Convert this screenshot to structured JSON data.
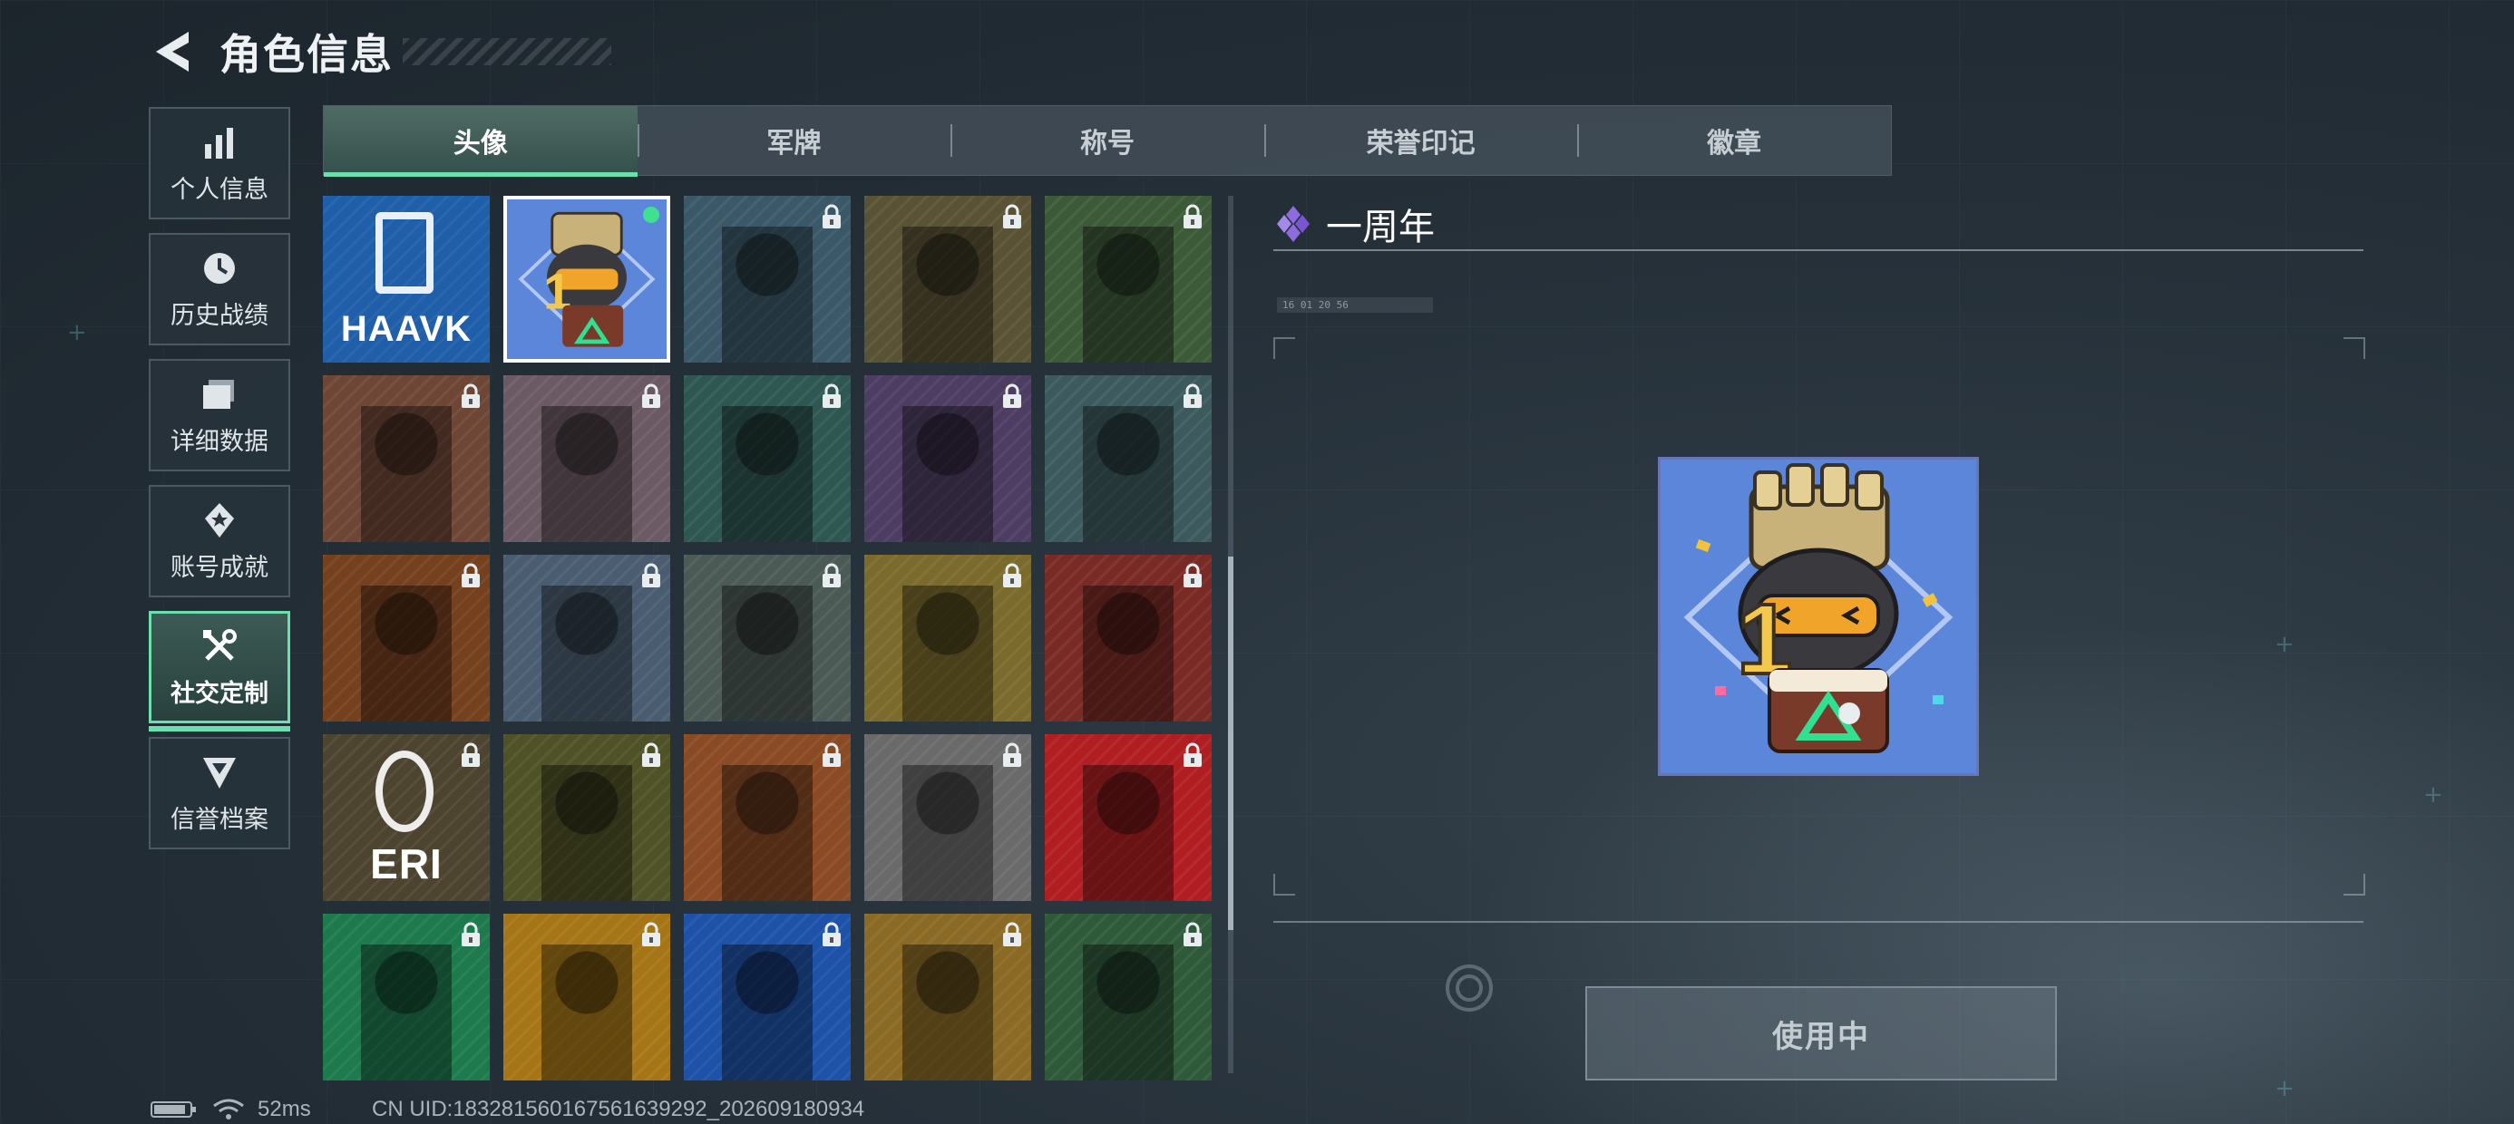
{
  "header": {
    "title": "角色信息"
  },
  "sidebar": {
    "items": [
      {
        "label": "个人信息",
        "icon": "bar-chart-icon"
      },
      {
        "label": "历史战绩",
        "icon": "history-clock-icon"
      },
      {
        "label": "详细数据",
        "icon": "folder-icon"
      },
      {
        "label": "账号成就",
        "icon": "medal-icon"
      },
      {
        "label": "社交定制",
        "icon": "tools-icon",
        "active": true
      },
      {
        "label": "信誉档案",
        "icon": "shield-chevron-icon"
      }
    ]
  },
  "tabs": [
    {
      "label": "头像",
      "active": true
    },
    {
      "label": "军牌"
    },
    {
      "label": "称号"
    },
    {
      "label": "荣誉印记"
    },
    {
      "label": "徽章"
    }
  ],
  "avatar_grid": {
    "columns": 5,
    "items": [
      {
        "name": "haavk-logo",
        "logo_text": "HAAVK",
        "bg": "#1f5ea8",
        "locked": false
      },
      {
        "name": "anniversary-mascot",
        "bg": "#4e7fd6",
        "locked": false,
        "selected": true,
        "equipped": true
      },
      {
        "name": "pilot-woman",
        "bg": "#3a5868",
        "locked": true
      },
      {
        "name": "bald-operator",
        "bg": "#5a5234",
        "locked": true
      },
      {
        "name": "headset-operator",
        "bg": "#3c5a38",
        "locked": true
      },
      {
        "name": "helmet-soldier",
        "bg": "#6e4636",
        "locked": true
      },
      {
        "name": "white-hair-woman",
        "bg": "#6b5a64",
        "locked": true
      },
      {
        "name": "glasses-operator",
        "bg": "#2f5752",
        "locked": true
      },
      {
        "name": "purple-hair-woman",
        "bg": "#4d3d62",
        "locked": true
      },
      {
        "name": "masked-soldier",
        "bg": "#3c5a5e",
        "locked": true
      },
      {
        "name": "scarf-operator",
        "bg": "#74401e",
        "locked": true
      },
      {
        "name": "gear-star-emblem",
        "bg": "#4a5d70",
        "locked": true
      },
      {
        "name": "helicopter-field",
        "bg": "#4c5a56",
        "locked": true
      },
      {
        "name": "mascot-eating",
        "bg": "#7a6a2c",
        "locked": true
      },
      {
        "name": "red-hair-woman",
        "bg": "#7a2a24",
        "locked": true
      },
      {
        "name": "eri-globe-emblem",
        "logo_text": "ERI",
        "bg": "#4d4430",
        "locked": true
      },
      {
        "name": "glasses-man",
        "bg": "#4f5226",
        "locked": true
      },
      {
        "name": "explosion",
        "bg": "#8a4a24",
        "locked": true
      },
      {
        "name": "pistol-soldier",
        "bg": "#6a6a6a",
        "locked": true
      },
      {
        "name": "shield-emblem-red",
        "bg": "#b01e22",
        "locked": true
      },
      {
        "name": "cross-emblem-green",
        "bg": "#1d7a4c",
        "locked": true
      },
      {
        "name": "a-emblem-orange",
        "bg": "#a67616",
        "locked": true
      },
      {
        "name": "hex-emblem-blue",
        "bg": "#1d52a8",
        "locked": true
      },
      {
        "name": "diamond-emblem-gold",
        "bg": "#8a6a24",
        "locked": true
      },
      {
        "name": "cap-woman",
        "bg": "#2f5a3a",
        "locked": true
      }
    ]
  },
  "detail": {
    "title": "一周年",
    "title_icon": "purple-diamond-icon",
    "meta_text": "16 01  20 56",
    "button_label": "使用中"
  },
  "status": {
    "ping": "52ms",
    "uid": "CN UID:18328156016756163929​2_202609180934"
  },
  "colors": {
    "accent": "#6cdfae",
    "equipped_dot": "#3fe08f",
    "title_icon": "#8f6be0"
  }
}
